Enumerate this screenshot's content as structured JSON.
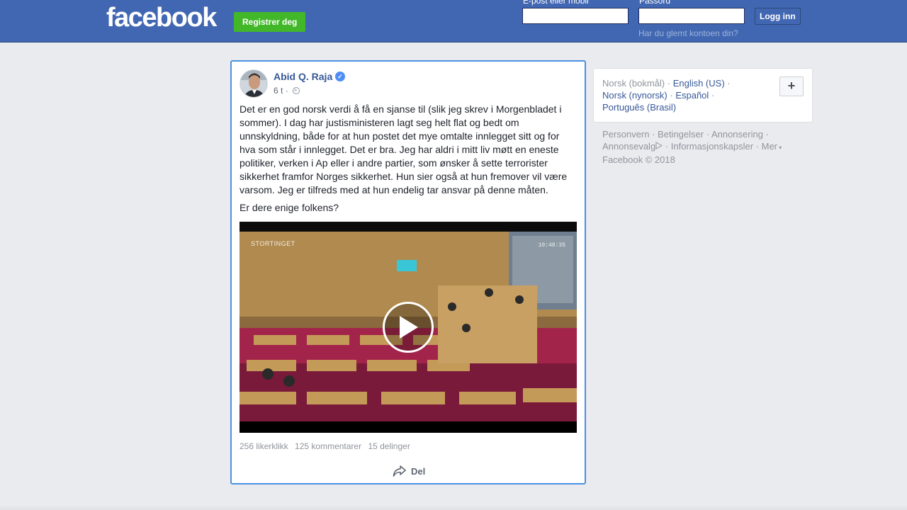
{
  "header": {
    "logo": "facebook",
    "register_label": "Registrer deg",
    "email_label": "E-post eller mobil",
    "email_value": "",
    "password_label": "Passord",
    "password_value": "",
    "login_label": "Logg inn",
    "forgot_label": "Har du glemt kontoen din?"
  },
  "post": {
    "author": "Abid Q. Raja",
    "time": "6 t",
    "separator": "·",
    "paragraphs": [
      "Det er en god norsk verdi å få en sjanse til (slik jeg skrev i Morgenbladet i sommer). I dag har justisministeren lagt seg helt flat og bedt om unnskyldning, både for at hun postet det mye omtalte innlegget sitt og for hva som står i innlegget. Det er bra. Jeg har aldri i mitt liv møtt en eneste politiker, verken i Ap eller i andre partier, som ønsker å sette terrorister sikkerhet framfor Norges sikkerhet. Hun sier også at hun fremover vil være varsom. Jeg er tilfreds med at hun endelig tar ansvar på denne måten.",
      "Er dere enige folkens?"
    ],
    "video": {
      "overlay_logo": "STORTINGET",
      "overlay_time": "10:48:35"
    },
    "stats": {
      "likes": "256 likerklikk",
      "comments": "125 kommentarer",
      "shares": "15 delinger"
    },
    "share_label": "Del"
  },
  "languages": {
    "current": "Norsk (bokmål)",
    "english": "English (US)",
    "nynorsk": "Norsk (nynorsk)",
    "spanish": "Español",
    "portuguese": "Português (Brasil)",
    "more_label": "+"
  },
  "footer": {
    "privacy": "Personvern",
    "terms": "Betingelser",
    "advertising": "Annonsering",
    "ad_choices": "Annonsevalg",
    "cookies": "Informasjonskapsler",
    "more": "Mer",
    "copyright": "Facebook © 2018"
  },
  "colors": {
    "brand_blue": "#4267b2",
    "register_green": "#42b72a",
    "link_blue": "#365899",
    "focus_border": "#4a90e2"
  }
}
